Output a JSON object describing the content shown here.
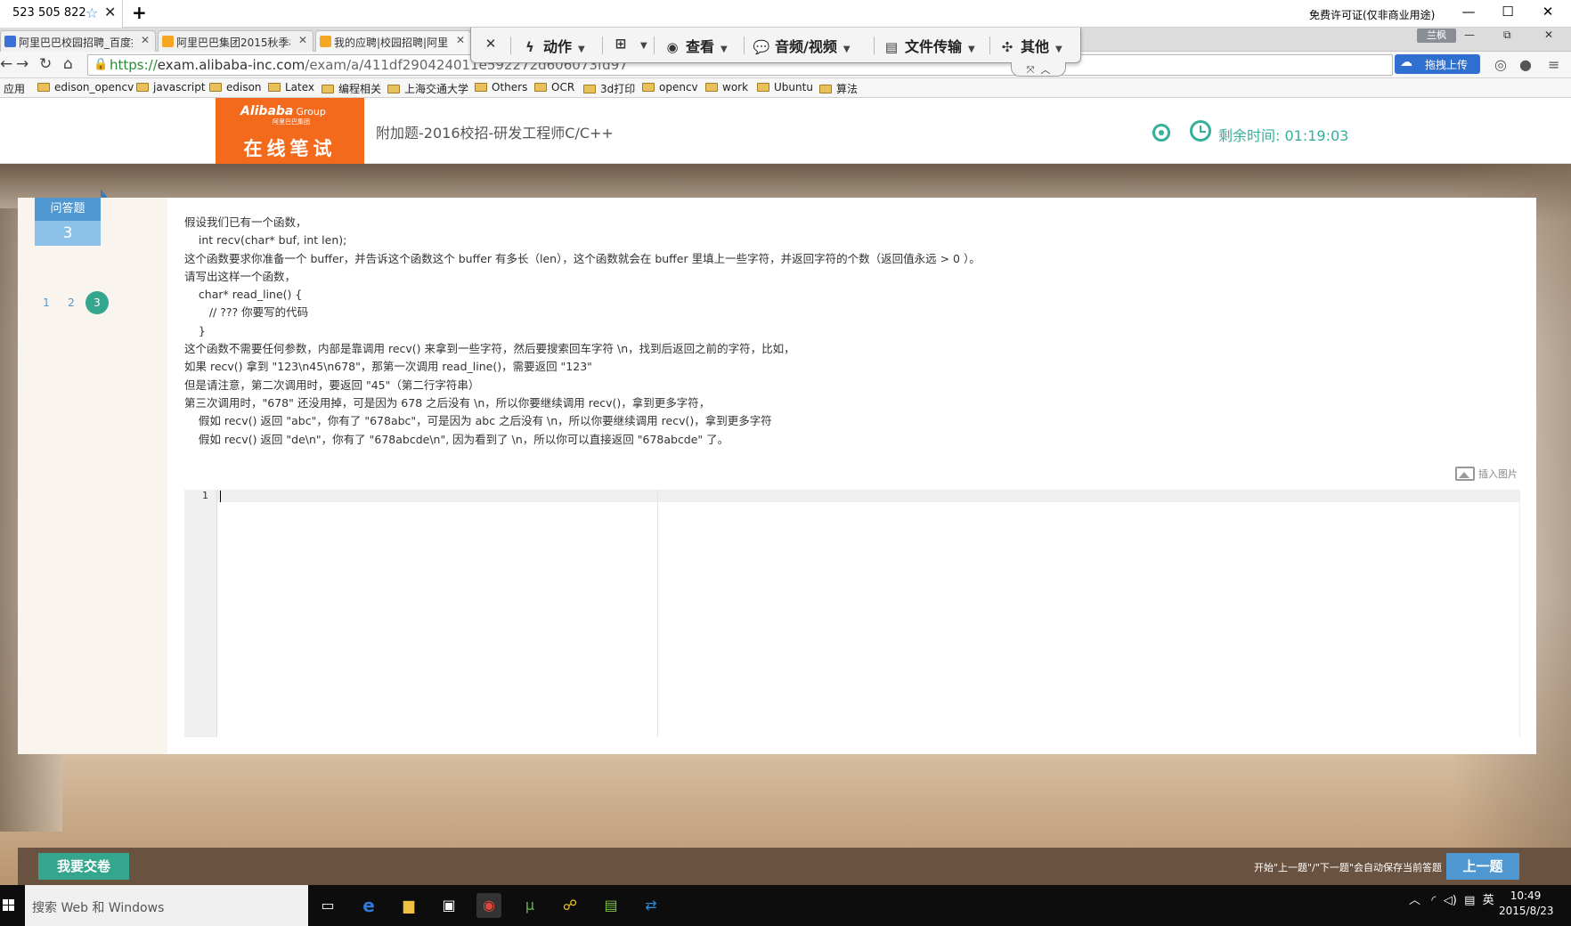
{
  "remote_window": {
    "tab_title": "523 505 822",
    "license_text": "免费许可证(仅非商业用途)"
  },
  "browser": {
    "tabs": [
      {
        "title": "阿里巴巴校园招聘_百度搜",
        "fav_color": "#3a6fd8"
      },
      {
        "title": "阿里巴巴集团2015秋季校",
        "fav_color": "#f5a623"
      },
      {
        "title": "我的应聘|校园招聘|阿里巴",
        "fav_color": "#f5a623"
      }
    ],
    "user_badge": "兰枫",
    "url_scheme": "https://",
    "url_host": "exam.alibaba-inc.com",
    "url_path": "/exam/a/411df290424011e592272d606073fd97",
    "upload_label": "拖拽上传",
    "bookmarks": [
      "应用",
      "edison_opencv",
      "javascript",
      "edison",
      "Latex",
      "编程相关",
      "上海交通大学",
      "Others",
      "OCR",
      "3d打印",
      "opencv",
      "work",
      "Ubuntu",
      "算法"
    ]
  },
  "remote_toolbar": {
    "items": [
      {
        "label": "动作",
        "icon": "lightning-icon"
      },
      {
        "label": "",
        "icon": "windows-icon"
      },
      {
        "label": "查看",
        "icon": "eye-icon"
      },
      {
        "label": "音频/视频",
        "icon": "chat-icon"
      },
      {
        "label": "文件传输",
        "icon": "files-icon"
      },
      {
        "label": "其他",
        "icon": "puzzle-icon"
      }
    ]
  },
  "header": {
    "brand": "Alibaba",
    "brand_group": "Group",
    "brand_cn": "阿里巴巴集团",
    "online_exam": "在线笔试",
    "exam_title": "附加题-2016校招-研发工程师C/C++",
    "timer": "剩余时间: 01:19:03"
  },
  "sidebar": {
    "question_type": "问答题",
    "question_count": "3",
    "nav": [
      "1",
      "2",
      "3"
    ],
    "current": "3"
  },
  "question": {
    "lines": [
      "假设我们已有一个函数，",
      "    int recv(char* buf, int len);",
      "这个函数要求你准备一个 buffer，并告诉这个函数这个 buffer 有多长（len），这个函数就会在 buffer 里填上一些字符，并返回字符的个数（返回值永远 > 0 ）。",
      "请写出这样一个函数，",
      "    char* read_line() {",
      "       // ??? 你要写的代码",
      "    }",
      "这个函数不需要任何参数，内部是靠调用 recv() 来拿到一些字符，然后要搜索回车字符 \\n，找到后返回之前的字符，比如，",
      "如果 recv() 拿到 \"123\\n45\\n678\"，那第一次调用 read_line()，需要返回 \"123\"",
      "但是请注意，第二次调用时，要返回 \"45\"（第二行字符串）",
      "第三次调用时，\"678\" 还没用掉，可是因为 678 之后没有 \\n，所以你要继续调用 recv()，拿到更多字符，",
      "    假如 recv() 返回 \"abc\"，你有了 \"678abc\"，可是因为 abc 之后没有 \\n，所以你要继续调用 recv()，拿到更多字符",
      "    假如 recv() 返回 \"de\\n\"，你有了 \"678abcde\\n\", 因为看到了 \\n，所以你可以直接返回 \"678abcde\" 了。"
    ],
    "insert_image": "插入图片",
    "editor_line_number": "1"
  },
  "footer": {
    "submit": "我要交卷",
    "autosave_note": "开始\"上一题\"/\"下一题\"会自动保存当前答题",
    "prev": "上一题"
  },
  "taskbar": {
    "search_placeholder": "搜索 Web 和 Windows",
    "ime": "英",
    "time": "10:49",
    "date": "2015/8/23"
  }
}
